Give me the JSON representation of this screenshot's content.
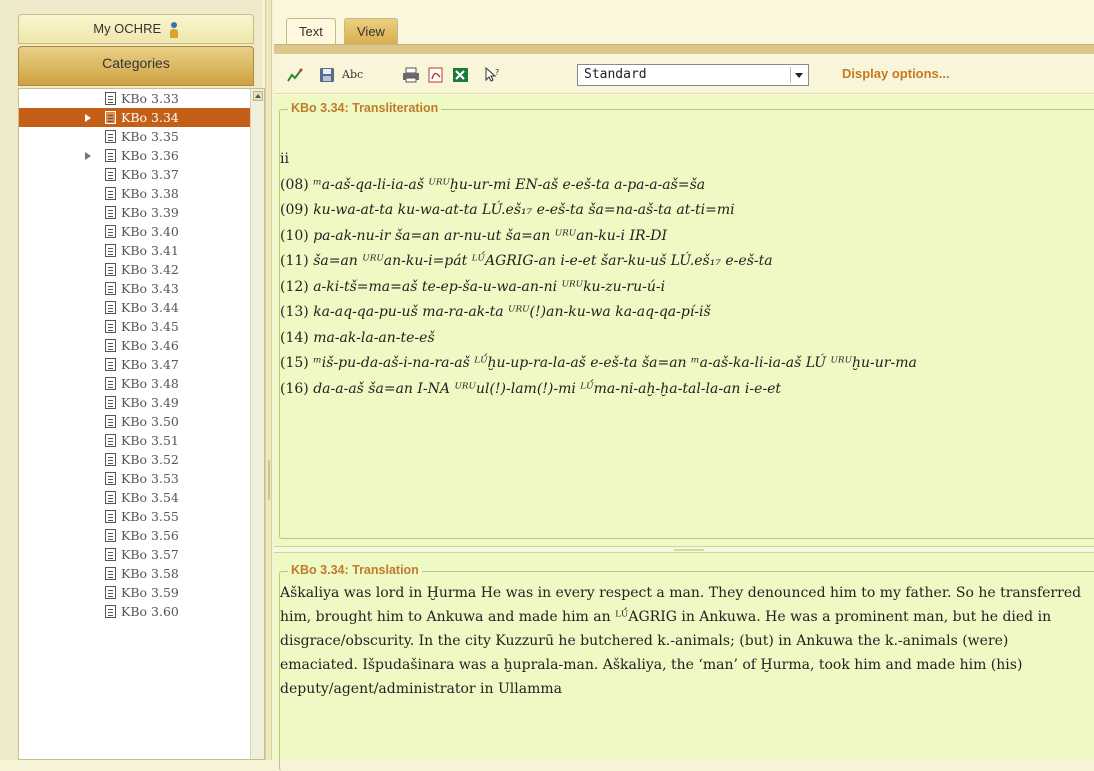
{
  "sidebar": {
    "my_ochre_label": "My OCHRE",
    "categories_label": "Categories",
    "items": [
      {
        "label": "KBo 3.33",
        "selected": false,
        "expandable": false
      },
      {
        "label": "KBo 3.34",
        "selected": true,
        "expandable": true
      },
      {
        "label": "KBo 3.35",
        "selected": false,
        "expandable": false
      },
      {
        "label": "KBo 3.36",
        "selected": false,
        "expandable": true
      },
      {
        "label": "KBo 3.37",
        "selected": false,
        "expandable": false
      },
      {
        "label": "KBo 3.38",
        "selected": false,
        "expandable": false
      },
      {
        "label": "KBo 3.39",
        "selected": false,
        "expandable": false
      },
      {
        "label": "KBo 3.40",
        "selected": false,
        "expandable": false
      },
      {
        "label": "KBo 3.41",
        "selected": false,
        "expandable": false
      },
      {
        "label": "KBo 3.42",
        "selected": false,
        "expandable": false
      },
      {
        "label": "KBo 3.43",
        "selected": false,
        "expandable": false
      },
      {
        "label": "KBo 3.44",
        "selected": false,
        "expandable": false
      },
      {
        "label": "KBo 3.45",
        "selected": false,
        "expandable": false
      },
      {
        "label": "KBo 3.46",
        "selected": false,
        "expandable": false
      },
      {
        "label": "KBo 3.47",
        "selected": false,
        "expandable": false
      },
      {
        "label": "KBo 3.48",
        "selected": false,
        "expandable": false
      },
      {
        "label": "KBo 3.49",
        "selected": false,
        "expandable": false
      },
      {
        "label": "KBo 3.50",
        "selected": false,
        "expandable": false
      },
      {
        "label": "KBo 3.51",
        "selected": false,
        "expandable": false
      },
      {
        "label": "KBo 3.52",
        "selected": false,
        "expandable": false
      },
      {
        "label": "KBo 3.53",
        "selected": false,
        "expandable": false
      },
      {
        "label": "KBo 3.54",
        "selected": false,
        "expandable": false
      },
      {
        "label": "KBo 3.55",
        "selected": false,
        "expandable": false
      },
      {
        "label": "KBo 3.56",
        "selected": false,
        "expandable": false
      },
      {
        "label": "KBo 3.57",
        "selected": false,
        "expandable": false
      },
      {
        "label": "KBo 3.58",
        "selected": false,
        "expandable": false
      },
      {
        "label": "KBo 3.59",
        "selected": false,
        "expandable": false
      },
      {
        "label": "KBo 3.60",
        "selected": false,
        "expandable": false
      }
    ]
  },
  "tabs": [
    {
      "label": "Text",
      "active": false
    },
    {
      "label": "View",
      "active": true
    }
  ],
  "toolbar": {
    "icons": [
      "chart-icon",
      "save-icon",
      "spellcheck-icon",
      "print-icon",
      "pdf-icon",
      "excel-icon",
      "help-cursor-icon"
    ],
    "spell_label": "Abc",
    "view_select_value": "Standard",
    "display_options_label": "Display options..."
  },
  "transliteration": {
    "heading": "KBo 3.34: Transliteration",
    "column_marker": "ii",
    "lines": [
      {
        "num": "(08)",
        "text": "ᵐa-aš-qa-li-ia-aš ᵁᴿᵁḫu-ur-mi EN-aš e-eš-ta a-pa-a-aš=ša"
      },
      {
        "num": "(09)",
        "text": "ku-wa-at-ta ku-wa-at-ta LÚ.eš₁₇ e-eš-ta ša=na-aš-ta at-ti=mi"
      },
      {
        "num": "(10)",
        "text": "pa-ak-nu-ir ša=an ar-nu-ut ša=an ᵁᴿᵁan-ku-i IR-DI"
      },
      {
        "num": "(11)",
        "text": "ša=an ᵁᴿᵁan-ku-i=pát ᴸᵁ́AGRIG-an i-e-et šar-ku-uš LÚ.eš₁₇ e-eš-ta"
      },
      {
        "num": "(12)",
        "text": "a-ki-tš=ma=aš te-ep-ša-u-wa-an-ni ᵁᴿᵁku-zu-ru-ú-i"
      },
      {
        "num": "(13)",
        "text": "ka-aq-qa-pu-uš ma-ra-ak-ta ᵁᴿᵁ(!)an-ku-wa ka-aq-qa-pí-iš"
      },
      {
        "num": "(14)",
        "text": "ma-ak-la-an-te-eš"
      },
      {
        "num": "(15)",
        "text": "ᵐiš-pu-da-aš-i-na-ra-aš ᴸᵁ́ḫu-up-ra-la-aš e-eš-ta ša=an ᵐa-aš-ka-li-ia-aš LÚ ᵁᴿᵁḫu-ur-ma"
      },
      {
        "num": "(16)",
        "text": "da-a-aš ša=an I-NA ᵁᴿᵁul(!)-lam(!)-mi ᴸᵁ́ma-ni-aḫ-ḫa-tal-la-an i-e-et"
      }
    ]
  },
  "translation": {
    "heading": "KBo 3.34: Translation",
    "text": "Aškaliya was lord in Ḫurma He was in every respect a man. They denounced him to my father. So he transferred him, brought him to Ankuwa and made him an ᴸᵁ́AGRIG in Ankuwa. He was a prominent man, but he died in disgrace/obscurity. In the city Kuzzurū he butchered k.-animals; (but) in Ankuwa the k.-animals (were) emaciated. Išpudašinara was a ḫuprala-man. Aškaliya, the ‘man’ of Ḫurma, took him and made him (his) deputy/agent/administrator in Ullamma"
  },
  "colors": {
    "selected_row": "#c55f17",
    "legend_text": "#c27a2c",
    "pane_bg": "#eef9c4",
    "display_options": "#c47a22"
  }
}
